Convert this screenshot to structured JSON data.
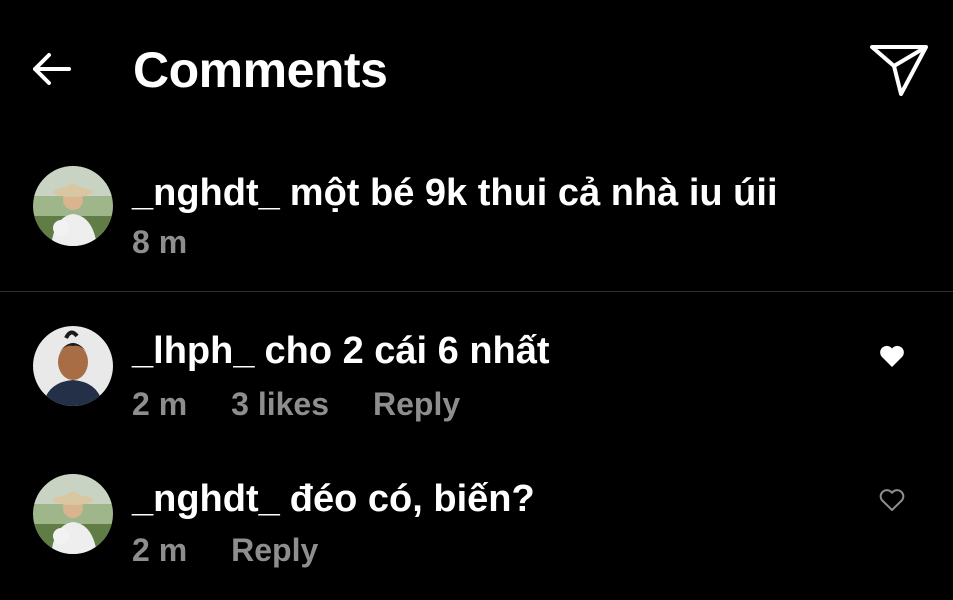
{
  "header": {
    "title": "Comments",
    "back_icon": "arrow-left-icon",
    "send_icon": "paper-plane-icon"
  },
  "caption": {
    "username": "_nghdt_",
    "text": "một bé 9k thui cả nhà iu úii",
    "time": "8 m"
  },
  "comments": [
    {
      "username": "_lhph_",
      "text": "cho 2 cái 6 nhất",
      "time": "2 m",
      "likes": "3 likes",
      "reply": "Reply",
      "liked": true
    },
    {
      "username": "_nghdt_",
      "text": "đéo có, biến?",
      "time": "2 m",
      "reply": "Reply",
      "liked": false
    }
  ],
  "colors": {
    "background": "#000000",
    "text": "#ffffff",
    "meta": "#8e8e8e",
    "divider": "#303030"
  }
}
